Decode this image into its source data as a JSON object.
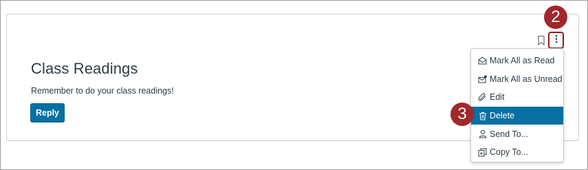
{
  "topic": {
    "title": "Class Readings",
    "message": "Remember to do your class readings!",
    "reply_label": "Reply"
  },
  "badges": {
    "options_step": "2",
    "delete_step": "3"
  },
  "menu": {
    "items": [
      {
        "label": "Mark All as Read",
        "icon": "envelope-open-icon"
      },
      {
        "label": "Mark All as Unread",
        "icon": "envelope-dot-icon"
      },
      {
        "label": "Edit",
        "icon": "paperclip-icon"
      },
      {
        "label": "Delete",
        "icon": "trash-icon",
        "active": true
      },
      {
        "label": "Send To...",
        "icon": "user-icon"
      },
      {
        "label": "Copy To...",
        "icon": "copy-icon"
      }
    ]
  },
  "colors": {
    "accent": "#0770a3",
    "badge": "#a1272b",
    "text": "#2d3b45",
    "border": "#c7cdd1"
  }
}
